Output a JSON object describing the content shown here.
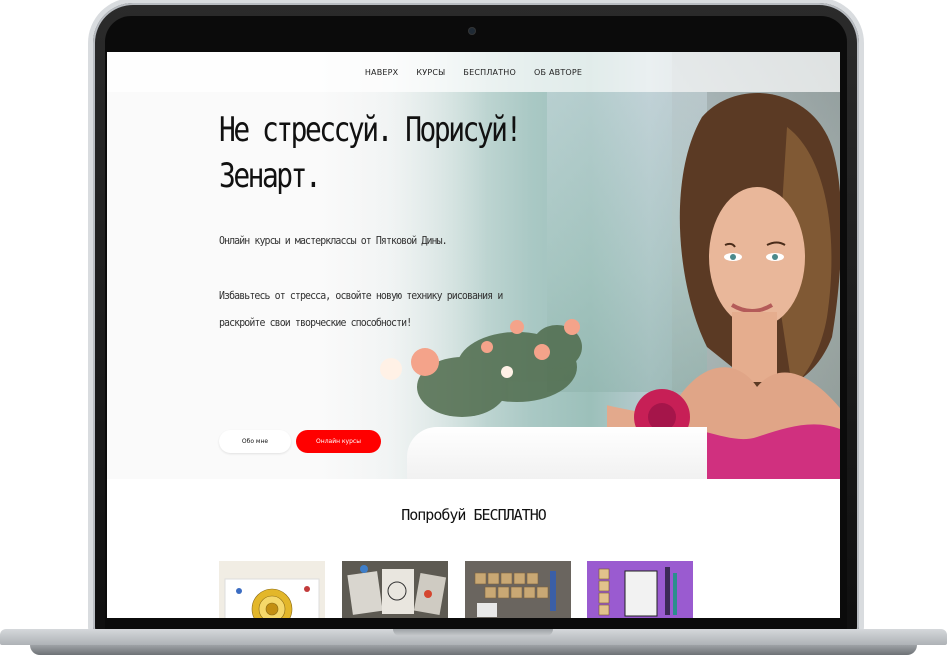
{
  "nav": {
    "items": [
      {
        "label": "НАВЕРХ"
      },
      {
        "label": "КУРСЫ"
      },
      {
        "label": "БЕСПЛАТНО"
      },
      {
        "label": "ОБ АВТОРЕ"
      }
    ]
  },
  "hero": {
    "title_line1": "Не стрессуй. Порисуй!",
    "title_line2": "Зенарт.",
    "subtitle": "Онлайн курсы и мастерклассы от Пятковой Дины.",
    "text_line1": "Избавьтесь от стресса, освойте новую технику рисования и",
    "text_line2": "раскройте свои творческие способности!"
  },
  "buttons": {
    "about_label": "Обо мне",
    "courses_label": "Онлайн курсы"
  },
  "free_section": {
    "title": "Попробуй БЕСПЛАТНО"
  },
  "colors": {
    "accent": "#ff0000",
    "card_purple": "#9a5bd0",
    "dress_pink": "#d0307f"
  }
}
